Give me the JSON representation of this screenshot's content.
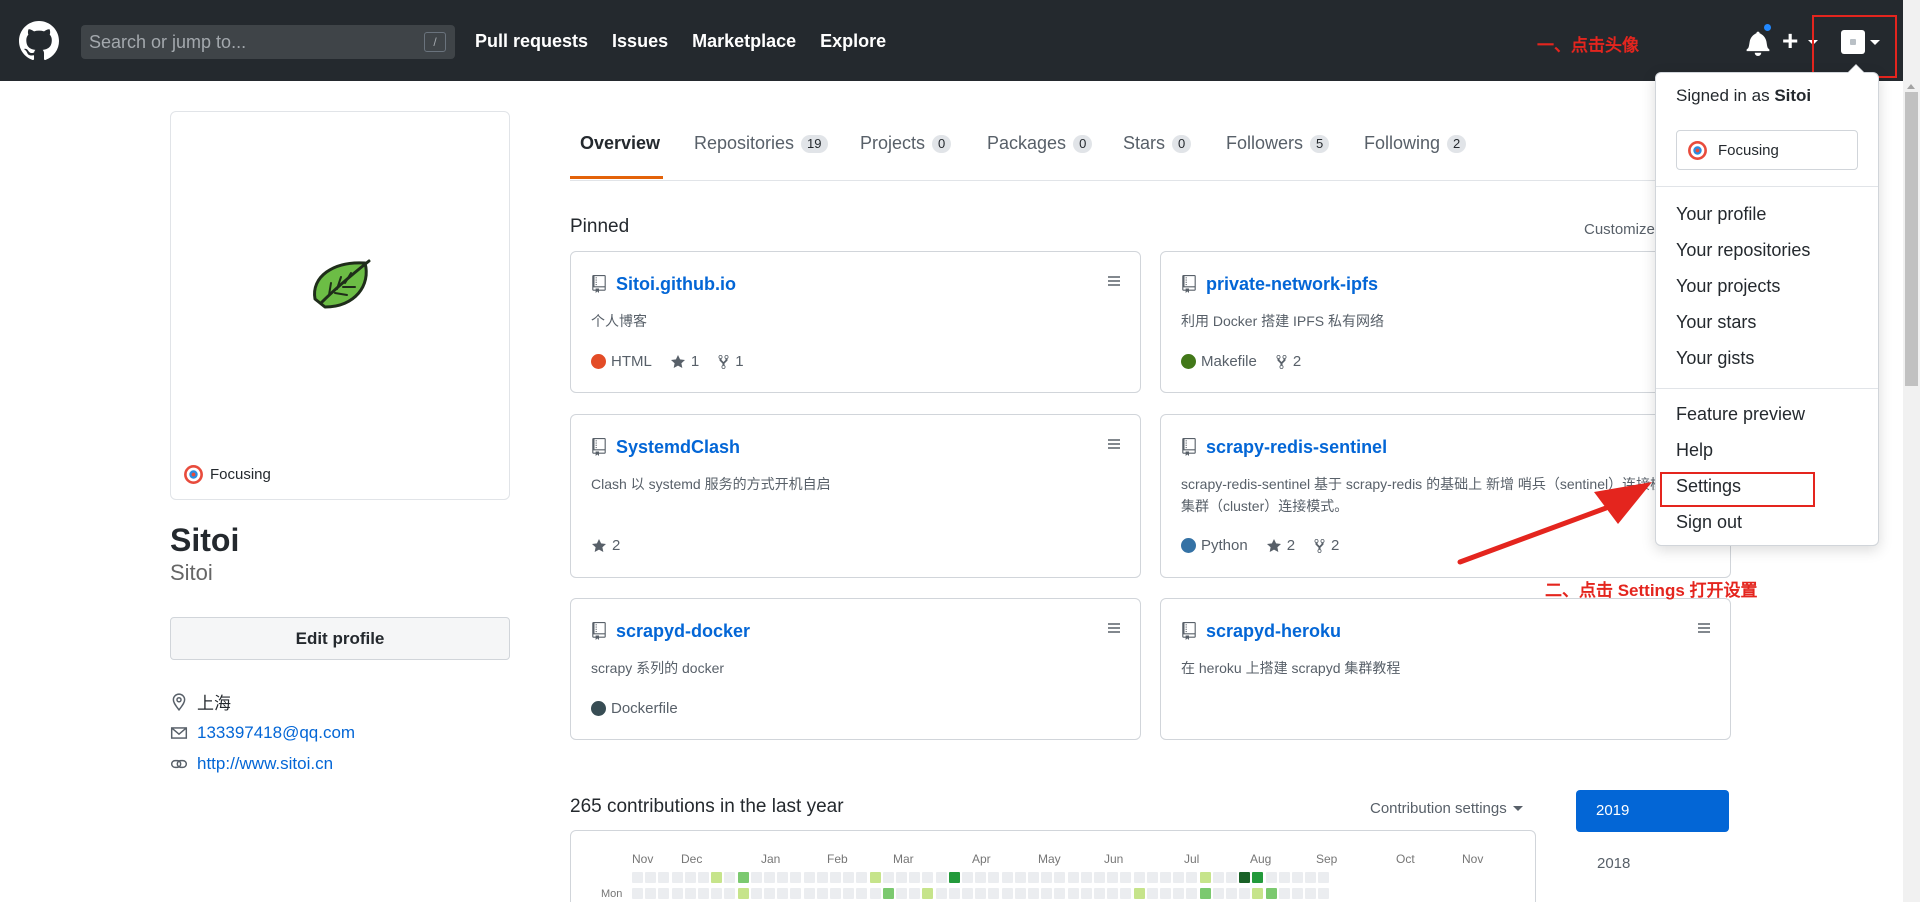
{
  "header": {
    "search_placeholder": "Search or jump to...",
    "search_shortcut": "/",
    "nav": [
      "Pull requests",
      "Issues",
      "Marketplace",
      "Explore"
    ],
    "plus_label": "+",
    "annotation_avatar": "一、点击头像"
  },
  "profile": {
    "status": "Focusing",
    "fullname": "Sitoi",
    "username": "Sitoi",
    "edit_button": "Edit profile",
    "location": "上海",
    "email": "133397418@qq.com",
    "website": "http://www.sitoi.cn"
  },
  "tabs": [
    {
      "label": "Overview",
      "count": ""
    },
    {
      "label": "Repositories",
      "count": "19"
    },
    {
      "label": "Projects",
      "count": "0"
    },
    {
      "label": "Packages",
      "count": "0"
    },
    {
      "label": "Stars",
      "count": "0"
    },
    {
      "label": "Followers",
      "count": "5"
    },
    {
      "label": "Following",
      "count": "2"
    }
  ],
  "pinned": {
    "title": "Pinned",
    "customize": "Customize",
    "repos": [
      {
        "name": "Sitoi.github.io",
        "desc": "个人博客",
        "lang": "HTML",
        "lang_color": "#e34c26",
        "stars": "1",
        "forks": "1"
      },
      {
        "name": "private-network-ipfs",
        "desc": "利用 Docker 搭建 IPFS 私有网络",
        "lang": "Makefile",
        "lang_color": "#427819",
        "stars": "",
        "forks": "2"
      },
      {
        "name": "SystemdClash",
        "desc": "Clash 以 systemd 服务的方式开机自启",
        "lang": "",
        "lang_color": "",
        "stars": "2",
        "forks": ""
      },
      {
        "name": "scrapy-redis-sentinel",
        "desc": "scrapy-redis-sentinel 基于 scrapy-redis 的基础上 新增 哨兵（sentinel）连接模式 以及 集群（cluster）连接模式。",
        "lang": "Python",
        "lang_color": "#3572a5",
        "stars": "2",
        "forks": "2"
      },
      {
        "name": "scrapyd-docker",
        "desc": "scrapy 系列的 docker",
        "lang": "Dockerfile",
        "lang_color": "#384d54",
        "stars": "",
        "forks": ""
      },
      {
        "name": "scrapyd-heroku",
        "desc": "在 heroku 上搭建 scrapyd 集群教程",
        "lang": "",
        "lang_color": "",
        "stars": "",
        "forks": ""
      }
    ]
  },
  "contributions": {
    "title": "265 contributions in the last year",
    "settings": "Contribution settings",
    "months": [
      "Nov",
      "Dec",
      "Jan",
      "Feb",
      "Mar",
      "Apr",
      "May",
      "Jun",
      "Jul",
      "Aug",
      "Sep",
      "Oct",
      "Nov"
    ],
    "day_label": "Mon",
    "years": [
      "2019",
      "2018"
    ]
  },
  "dropdown": {
    "signed_in_prefix": "Signed in as",
    "signed_in_user": "Sitoi",
    "status": "Focusing",
    "items_1": [
      "Your profile",
      "Your repositories",
      "Your projects",
      "Your stars",
      "Your gists"
    ],
    "items_2": [
      "Feature preview",
      "Help",
      "Settings",
      "Sign out"
    ],
    "annotation_settings": "二、点击 Settings 打开设置"
  },
  "colors": {
    "header_bg": "#24292e",
    "link": "#0366d6",
    "annotation": "#e4251e",
    "tab_accent": "#e36209"
  }
}
